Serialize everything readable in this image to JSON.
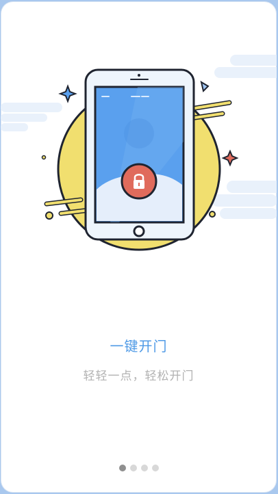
{
  "onboarding": {
    "title": "一键开门",
    "subtitle": "轻轻一点，轻松开门"
  },
  "pagination": {
    "total": 4,
    "active_index": 0
  },
  "colors": {
    "frame": "#a9c8ee",
    "title": "#4f9ae6",
    "subtitle": "#b2b2b2",
    "circle": "#f1df6f",
    "screen": "#5aa0ee",
    "lock": "#e06b5c",
    "outline": "#1f2430"
  },
  "icons": [
    "phone-illustration",
    "lock-icon",
    "sparkle-icon",
    "triangle-icon",
    "cloud-decoration"
  ]
}
